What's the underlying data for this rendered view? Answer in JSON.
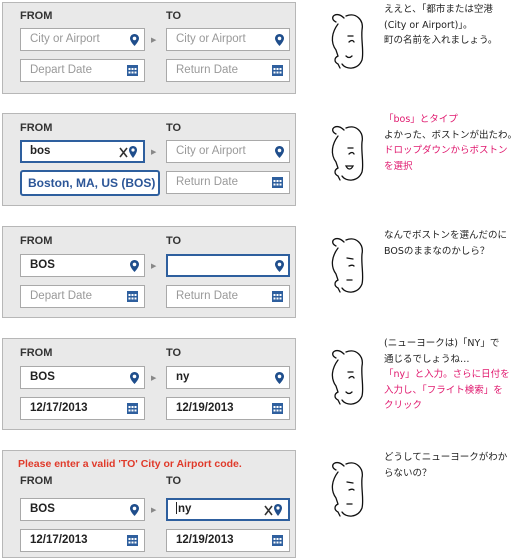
{
  "labels": {
    "from": "FROM",
    "to": "TO"
  },
  "placeholders": {
    "city": "City or Airport",
    "depart": "Depart Date",
    "return": "Return Date"
  },
  "colors": {
    "accent_blue": "#2e5f9e",
    "pin_blue": "#1f4e8c",
    "error_red": "#e03a2a",
    "note_pink": "#e0186e"
  },
  "icons": [
    "location-pin-icon",
    "calendar-icon",
    "clear-x-icon",
    "arrow-right-icon",
    "woman-face-icon"
  ],
  "steps": [
    {
      "note": [
        "ええと、「都市または空港",
        "(City or Airport)」。",
        "町の名前を入れましょう。"
      ]
    },
    {
      "from_value": "bos",
      "dropdown": "Boston, MA, US (BOS)",
      "note_pink_1": "「bos」とタイプ",
      "note_plain": "よかった、ボストンが出たわ。",
      "note_pink_2": [
        "ドロップダウンからボストン",
        "を選択"
      ]
    },
    {
      "from_value": "BOS",
      "note": [
        "なんでボストンを選んだのに",
        "BOSのままなのかしら？"
      ]
    },
    {
      "from_value": "BOS",
      "to_value": "ny",
      "depart_value": "12/17/2013",
      "return_value": "12/19/2013",
      "note_plain": [
        "(ニューヨークは)「NY」で",
        "通じるでしょうね…"
      ],
      "note_pink": [
        "「ny」と入力。さらに日付を",
        "入力し、「フライト検索」を",
        "クリック"
      ]
    },
    {
      "error": "Please enter a valid 'TO' City or Airport code.",
      "from_value": "BOS",
      "to_value": "ny",
      "depart_value": "12/17/2013",
      "return_value": "12/19/2013",
      "note": [
        "どうしてニューヨークがわか",
        "らないの？"
      ]
    }
  ]
}
